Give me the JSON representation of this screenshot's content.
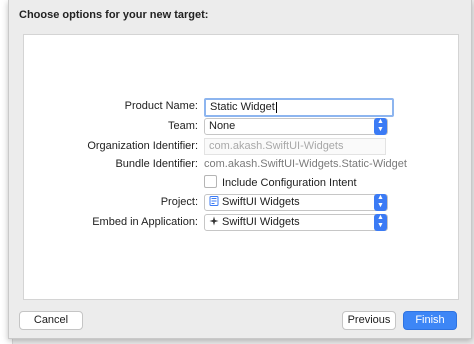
{
  "dialog": {
    "title": "Choose options for your new target:"
  },
  "form": {
    "product_name": {
      "label": "Product Name:",
      "value": "Static Widget"
    },
    "team": {
      "label": "Team:",
      "value": "None"
    },
    "organization_identifier": {
      "label": "Organization Identifier:",
      "placeholder": "com.akash.SwiftUI-Widgets"
    },
    "bundle_identifier": {
      "label": "Bundle Identifier:",
      "value": "com.akash.SwiftUI-Widgets.Static-Widget"
    },
    "include_configuration_intent": {
      "label": "Include Configuration Intent",
      "checked": false
    },
    "project": {
      "label": "Project:",
      "value": "SwiftUI Widgets",
      "icon": "xcode-project-icon"
    },
    "embed_in_application": {
      "label": "Embed in Application:",
      "value": "SwiftUI Widgets",
      "icon": "app-target-icon"
    }
  },
  "buttons": {
    "cancel": "Cancel",
    "previous": "Previous",
    "finish": "Finish"
  },
  "colors": {
    "accent": "#3d86f6",
    "focus_ring": "#8db5ef"
  }
}
